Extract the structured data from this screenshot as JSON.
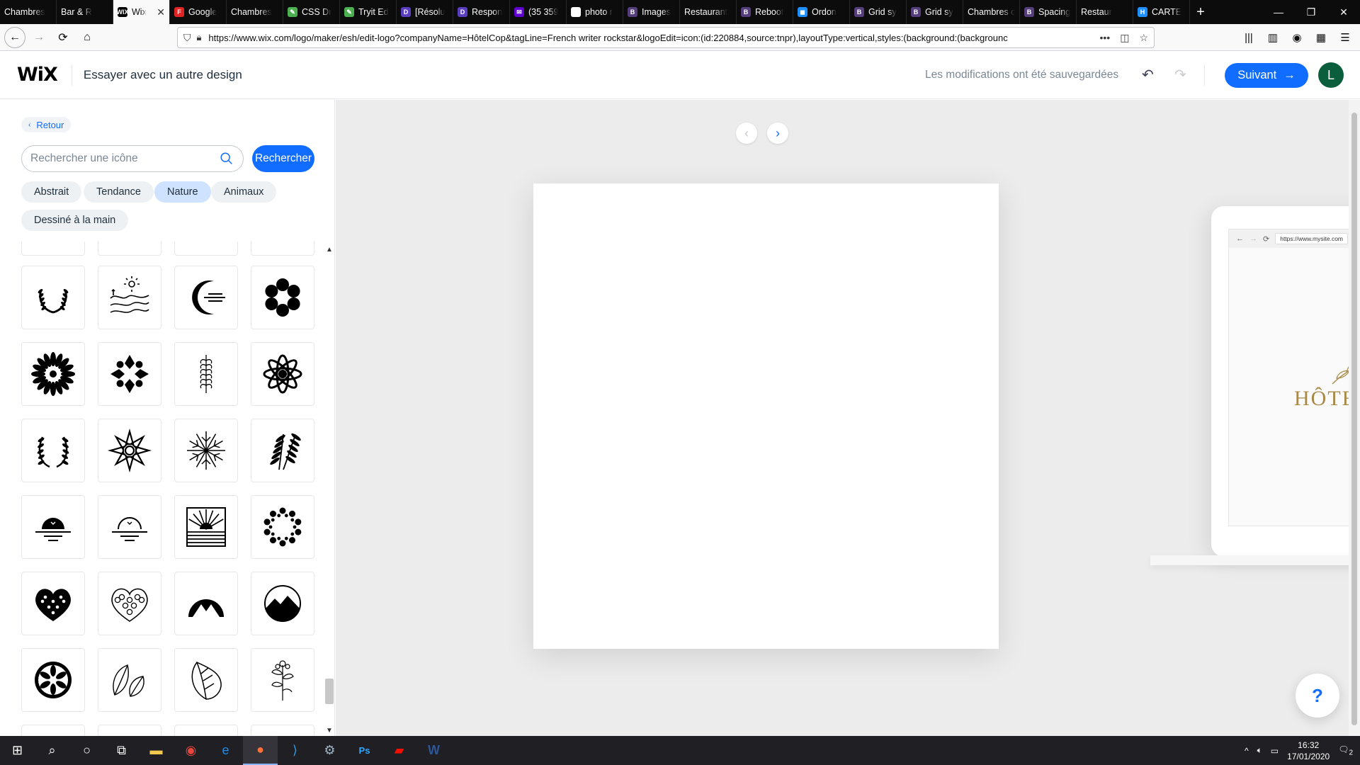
{
  "browser": {
    "tabs": [
      {
        "label": "Chambres",
        "fav": "",
        "color": "#0c0c0d"
      },
      {
        "label": "Bar & R",
        "fav": "",
        "color": "#555"
      },
      {
        "label": "Wix",
        "fav": "WIX",
        "color": "#000",
        "active": true
      },
      {
        "label": "Google",
        "fav": "F",
        "color": "#e02424"
      },
      {
        "label": "Chambres",
        "fav": "",
        "color": "#0c0c0d"
      },
      {
        "label": "CSS Dr",
        "fav": "✎",
        "color": "#4caf50"
      },
      {
        "label": "Tryit Ed",
        "fav": "✎",
        "color": "#4caf50"
      },
      {
        "label": "[Résolu",
        "fav": "D",
        "color": "#5a3fc0"
      },
      {
        "label": "Respon",
        "fav": "D",
        "color": "#5a3fc0"
      },
      {
        "label": "(35 359",
        "fav": "✉",
        "color": "#6001d2"
      },
      {
        "label": "photo r",
        "fav": "G",
        "color": "#fff"
      },
      {
        "label": "Images",
        "fav": "B",
        "color": "#563d7c"
      },
      {
        "label": "Restaurant",
        "fav": "",
        "color": "#0c0c0d"
      },
      {
        "label": "Reboot",
        "fav": "B",
        "color": "#563d7c"
      },
      {
        "label": "Ordon",
        "fav": "◼",
        "color": "#1e90ff"
      },
      {
        "label": "Grid sy",
        "fav": "B",
        "color": "#563d7c"
      },
      {
        "label": "Grid sy",
        "fav": "B",
        "color": "#563d7c"
      },
      {
        "label": "Chambres c",
        "fav": "",
        "color": "#0c0c0d"
      },
      {
        "label": "Spacing",
        "fav": "B",
        "color": "#563d7c"
      },
      {
        "label": "Restaur",
        "fav": "",
        "color": "#7a1f1f"
      },
      {
        "label": "CARTE",
        "fav": "H",
        "color": "#1e90ff"
      }
    ],
    "new_tab": "+",
    "url": "https://www.wix.com/logo/maker/esh/edit-logo?companyName=HôtelCop&tagLine=French writer rockstar&logoEdit=icon:(id:220884,source:tnpr),layoutType:vertical,styles:(background:(backgrounc"
  },
  "header": {
    "logo": "WiX",
    "title": "Essayer avec un autre design",
    "saved_status": "Les modifications ont été sauvegardées",
    "next_label": "Suivant",
    "next_arrow": "→",
    "avatar_letter": "L"
  },
  "panel": {
    "back_label": "Retour",
    "search_placeholder": "Rechercher une icône",
    "search_button": "Rechercher",
    "chips": [
      {
        "label": "Abstrait",
        "active": false
      },
      {
        "label": "Tendance",
        "active": false
      },
      {
        "label": "Nature",
        "active": true
      },
      {
        "label": "Animaux",
        "active": false
      },
      {
        "label": "Dessiné à la main",
        "active": false
      }
    ],
    "icons": [
      "laurel-wreath-icon",
      "sun-waves-landscape-icon",
      "crescent-moon-icon",
      "flower-petals-icon",
      "sunflower-mandala-icon",
      "snowflake-flower-icon",
      "wheat-sprig-icon",
      "geometric-flower-icon",
      "laurel-wreath-open-icon",
      "star-flower-icon",
      "snowflake-icon",
      "fern-leaves-icon",
      "sunset-filled-icon",
      "sunset-outline-icon",
      "sunrise-square-icon",
      "flower-wreath-icon",
      "floral-heart-filled-icon",
      "floral-heart-outline-icon",
      "mountain-arch-icon",
      "mountain-circle-icon",
      "ornamental-circle-icon",
      "two-leaves-icon",
      "leaf-outline-icon",
      "botanical-sprig-icon"
    ]
  },
  "canvas": {
    "preview_url": "https://www.mysite.com",
    "preview_company": "HÔTE",
    "help_label": "?"
  },
  "taskbar": {
    "time": "16:32",
    "date": "17/01/2020",
    "notifications": "2"
  },
  "colors": {
    "accent": "#116dff",
    "chip_active": "#cfe2ff",
    "avatar": "#0b5e3c",
    "gold": "#a88846"
  }
}
